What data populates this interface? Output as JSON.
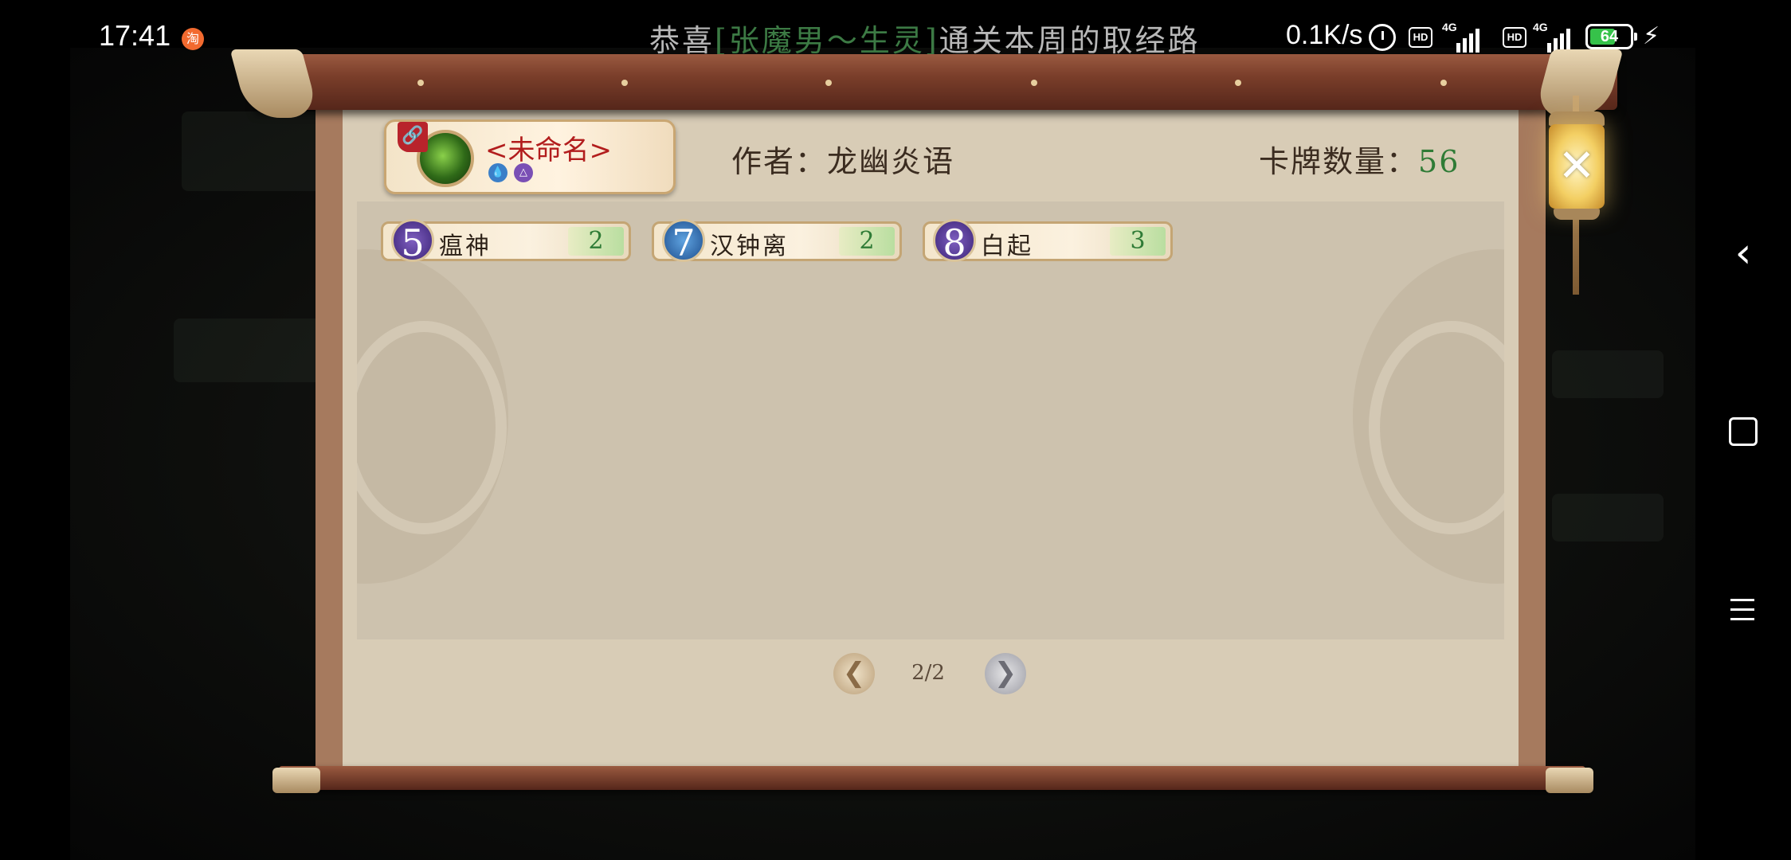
{
  "status_bar": {
    "time": "17:41",
    "app_notification_glyph": "淘",
    "marquee_prefix": "恭喜",
    "marquee_highlight": "[张魔男～生灵]",
    "marquee_suffix": "通关本周的取经路",
    "net_speed": "0.1K/s",
    "hd_label": "HD",
    "signal_label": "4G",
    "battery_level": "64",
    "battery_fraction": 0.64,
    "icons": [
      "alarm-icon",
      "hd-icon",
      "signal-icon",
      "battery-icon",
      "charging-icon"
    ]
  },
  "deck": {
    "name": "<未命名>",
    "element_icons": [
      "water-icon",
      "peak-icon"
    ],
    "author_label": "作者：龙幽炎语",
    "count_label": "卡牌数量：",
    "count_value": "56"
  },
  "cards": [
    {
      "cost": "5",
      "name": "瘟神",
      "qty": "2",
      "cost_color": "purple"
    },
    {
      "cost": "7",
      "name": "汉钟离",
      "qty": "2",
      "cost_color": "blue"
    },
    {
      "cost": "8",
      "name": "白起",
      "qty": "3",
      "cost_color": "purple"
    }
  ],
  "pager": {
    "indicator": "2/2",
    "prev_glyph": "❮",
    "next_glyph": "❯"
  },
  "close": {
    "glyph": "✕"
  },
  "nav": {
    "back_glyph": "‹"
  },
  "colors": {
    "highlight": "#3c7a44",
    "deck_name": "#b21d1d",
    "qty_green": "#2f7b36",
    "cost_purple": "#5a3a9c",
    "cost_blue": "#2f6fb0"
  }
}
